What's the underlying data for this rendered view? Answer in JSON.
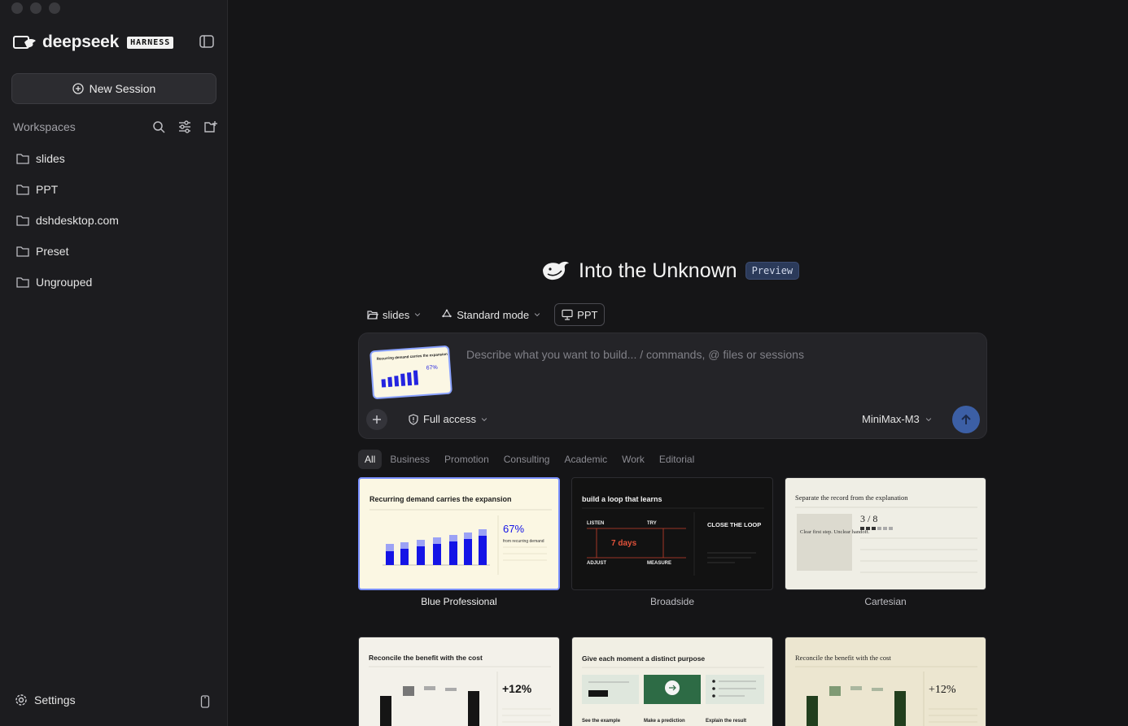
{
  "sidebar": {
    "brand_name": "deepseek",
    "brand_badge": "HARNESS",
    "new_session_label": "New Session",
    "workspaces_label": "Workspaces",
    "items": [
      {
        "label": "slides"
      },
      {
        "label": "PPT"
      },
      {
        "label": "dshdesktop.com"
      },
      {
        "label": "Preset"
      },
      {
        "label": "Ungrouped"
      }
    ],
    "settings_label": "Settings"
  },
  "main": {
    "title": "Into the Unknown",
    "badge": "Preview",
    "chips": {
      "folder": "slides",
      "mode": "Standard mode",
      "ppt": "PPT"
    },
    "composer": {
      "placeholder": "Describe what you want to build... / commands, @ files or sessions",
      "access_label": "Full access",
      "model_label": "MiniMax-M3"
    },
    "tabs": [
      "All",
      "Business",
      "Promotion",
      "Consulting",
      "Academic",
      "Work",
      "Editorial"
    ],
    "templates": [
      {
        "name": "Blue Professional",
        "slide_title": "Recurring demand carries the expansion",
        "stat": "67%",
        "stat_caption": "from recurring demand"
      },
      {
        "name": "Broadside",
        "slide_title": "build a loop that learns",
        "steps": [
          "LISTEN",
          "TRY",
          "ADJUST",
          "MEASURE"
        ],
        "center": "7 days",
        "side": "CLOSE THE LOOP"
      },
      {
        "name": "Cartesian",
        "slide_title": "Separate the record from the explanation",
        "figure": "3 / 8",
        "left_note": "Clear first step. Unclear handoff."
      },
      {
        "name": "",
        "slide_title": "Reconcile the benefit with the cost",
        "stat": "+12%"
      },
      {
        "name": "",
        "slide_title": "Give each moment a distinct purpose",
        "captions": [
          "See the example",
          "Make a prediction",
          "Explain the result"
        ]
      },
      {
        "name": "",
        "slide_title": "Reconcile the benefit with the cost",
        "stat": "+12%"
      }
    ]
  },
  "colors": {
    "accent": "#3c5fa5",
    "selected_border": "#7a90ff",
    "sidebar_bg": "#1c1c1f",
    "main_bg": "#151517"
  }
}
